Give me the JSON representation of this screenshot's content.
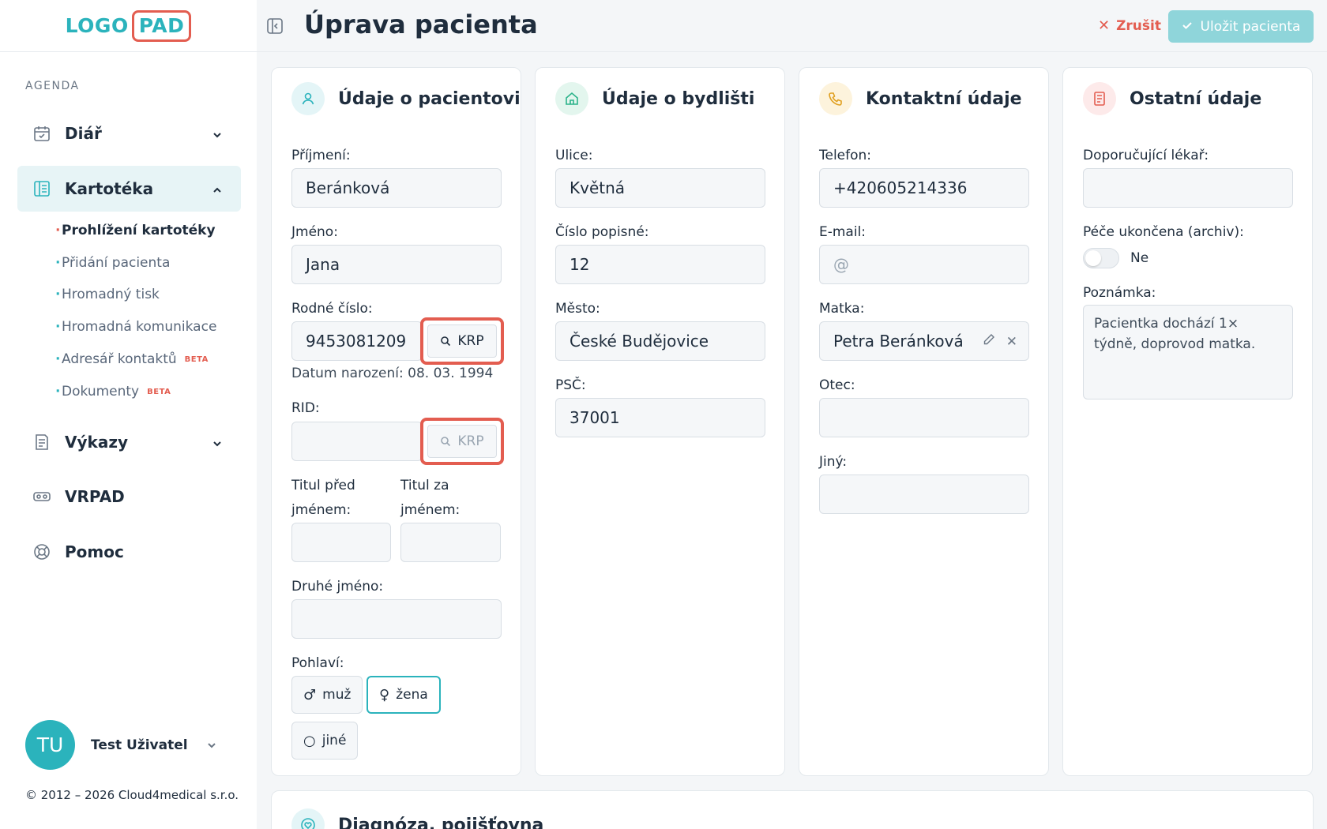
{
  "logo": {
    "part1": "LOGO",
    "part2": "PAD"
  },
  "sidebar": {
    "section_label": "AGENDA",
    "items": [
      {
        "label": "Diář"
      },
      {
        "label": "Kartotéka"
      },
      {
        "label": "Výkazy"
      },
      {
        "label": "VRPAD"
      },
      {
        "label": "Pomoc"
      }
    ],
    "sub_items": [
      {
        "label": "Prohlížení kartotéky"
      },
      {
        "label": "Přidání pacienta"
      },
      {
        "label": "Hromadný tisk"
      },
      {
        "label": "Hromadná komunikace"
      },
      {
        "label": "Adresář kontaktů",
        "badge": "BETA"
      },
      {
        "label": "Dokumenty",
        "badge": "BETA"
      }
    ],
    "user": {
      "initials": "TU",
      "name": "Test Uživatel"
    },
    "copyright": "© 2012 – 2026 Cloud4medical s.r.o."
  },
  "header": {
    "title": "Úprava pacienta",
    "cancel_label": "Zrušit",
    "save_label": "Uložit pacienta"
  },
  "patient": {
    "title": "Údaje o pacientovi",
    "surname_label": "Příjmení:",
    "surname": "Beránková",
    "name_label": "Jméno:",
    "name": "Jana",
    "birth_number_label": "Rodné číslo:",
    "birth_number": "9453081209",
    "krp_label": "KRP",
    "birth_date": "Datum narození: 08. 03. 1994",
    "rid_label": "RID:",
    "rid": "",
    "title_before_label_1": "Titul před",
    "title_before_label_2": "jménem:",
    "title_after_label_1": "Titul za",
    "title_after_label_2": "jménem:",
    "second_name_label": "Druhé jméno:",
    "gender_label": "Pohlaví:",
    "gender_options": [
      "muž",
      "žena",
      "jiné"
    ],
    "gender_selected": "žena"
  },
  "address": {
    "title": "Údaje o bydlišti",
    "street_label": "Ulice:",
    "street": "Květná",
    "number_label": "Číslo popisné:",
    "number": "12",
    "city_label": "Město:",
    "city": "České Budějovice",
    "zip_label": "PSČ:",
    "zip": "37001"
  },
  "contact": {
    "title": "Kontaktní údaje",
    "phone_label": "Telefon:",
    "phone": "+420605214336",
    "email_label": "E-mail:",
    "email_placeholder": "@",
    "mother_label": "Matka:",
    "mother": "Petra Beránková",
    "father_label": "Otec:",
    "other_label": "Jiný:"
  },
  "other": {
    "title": "Ostatní údaje",
    "doctor_label": "Doporučující lékař:",
    "archive_label": "Péče ukončena (archiv):",
    "archive_value": "Ne",
    "note_label": "Poznámka:",
    "note": "Pacientka dochází 1× týdně, doprovod matka."
  },
  "diagnosis": {
    "title": "Diagnóza, pojišťovna"
  },
  "colors": {
    "accent": "#2bb3bc",
    "danger": "#e35d50",
    "save_disabled": "#8fd5da"
  }
}
